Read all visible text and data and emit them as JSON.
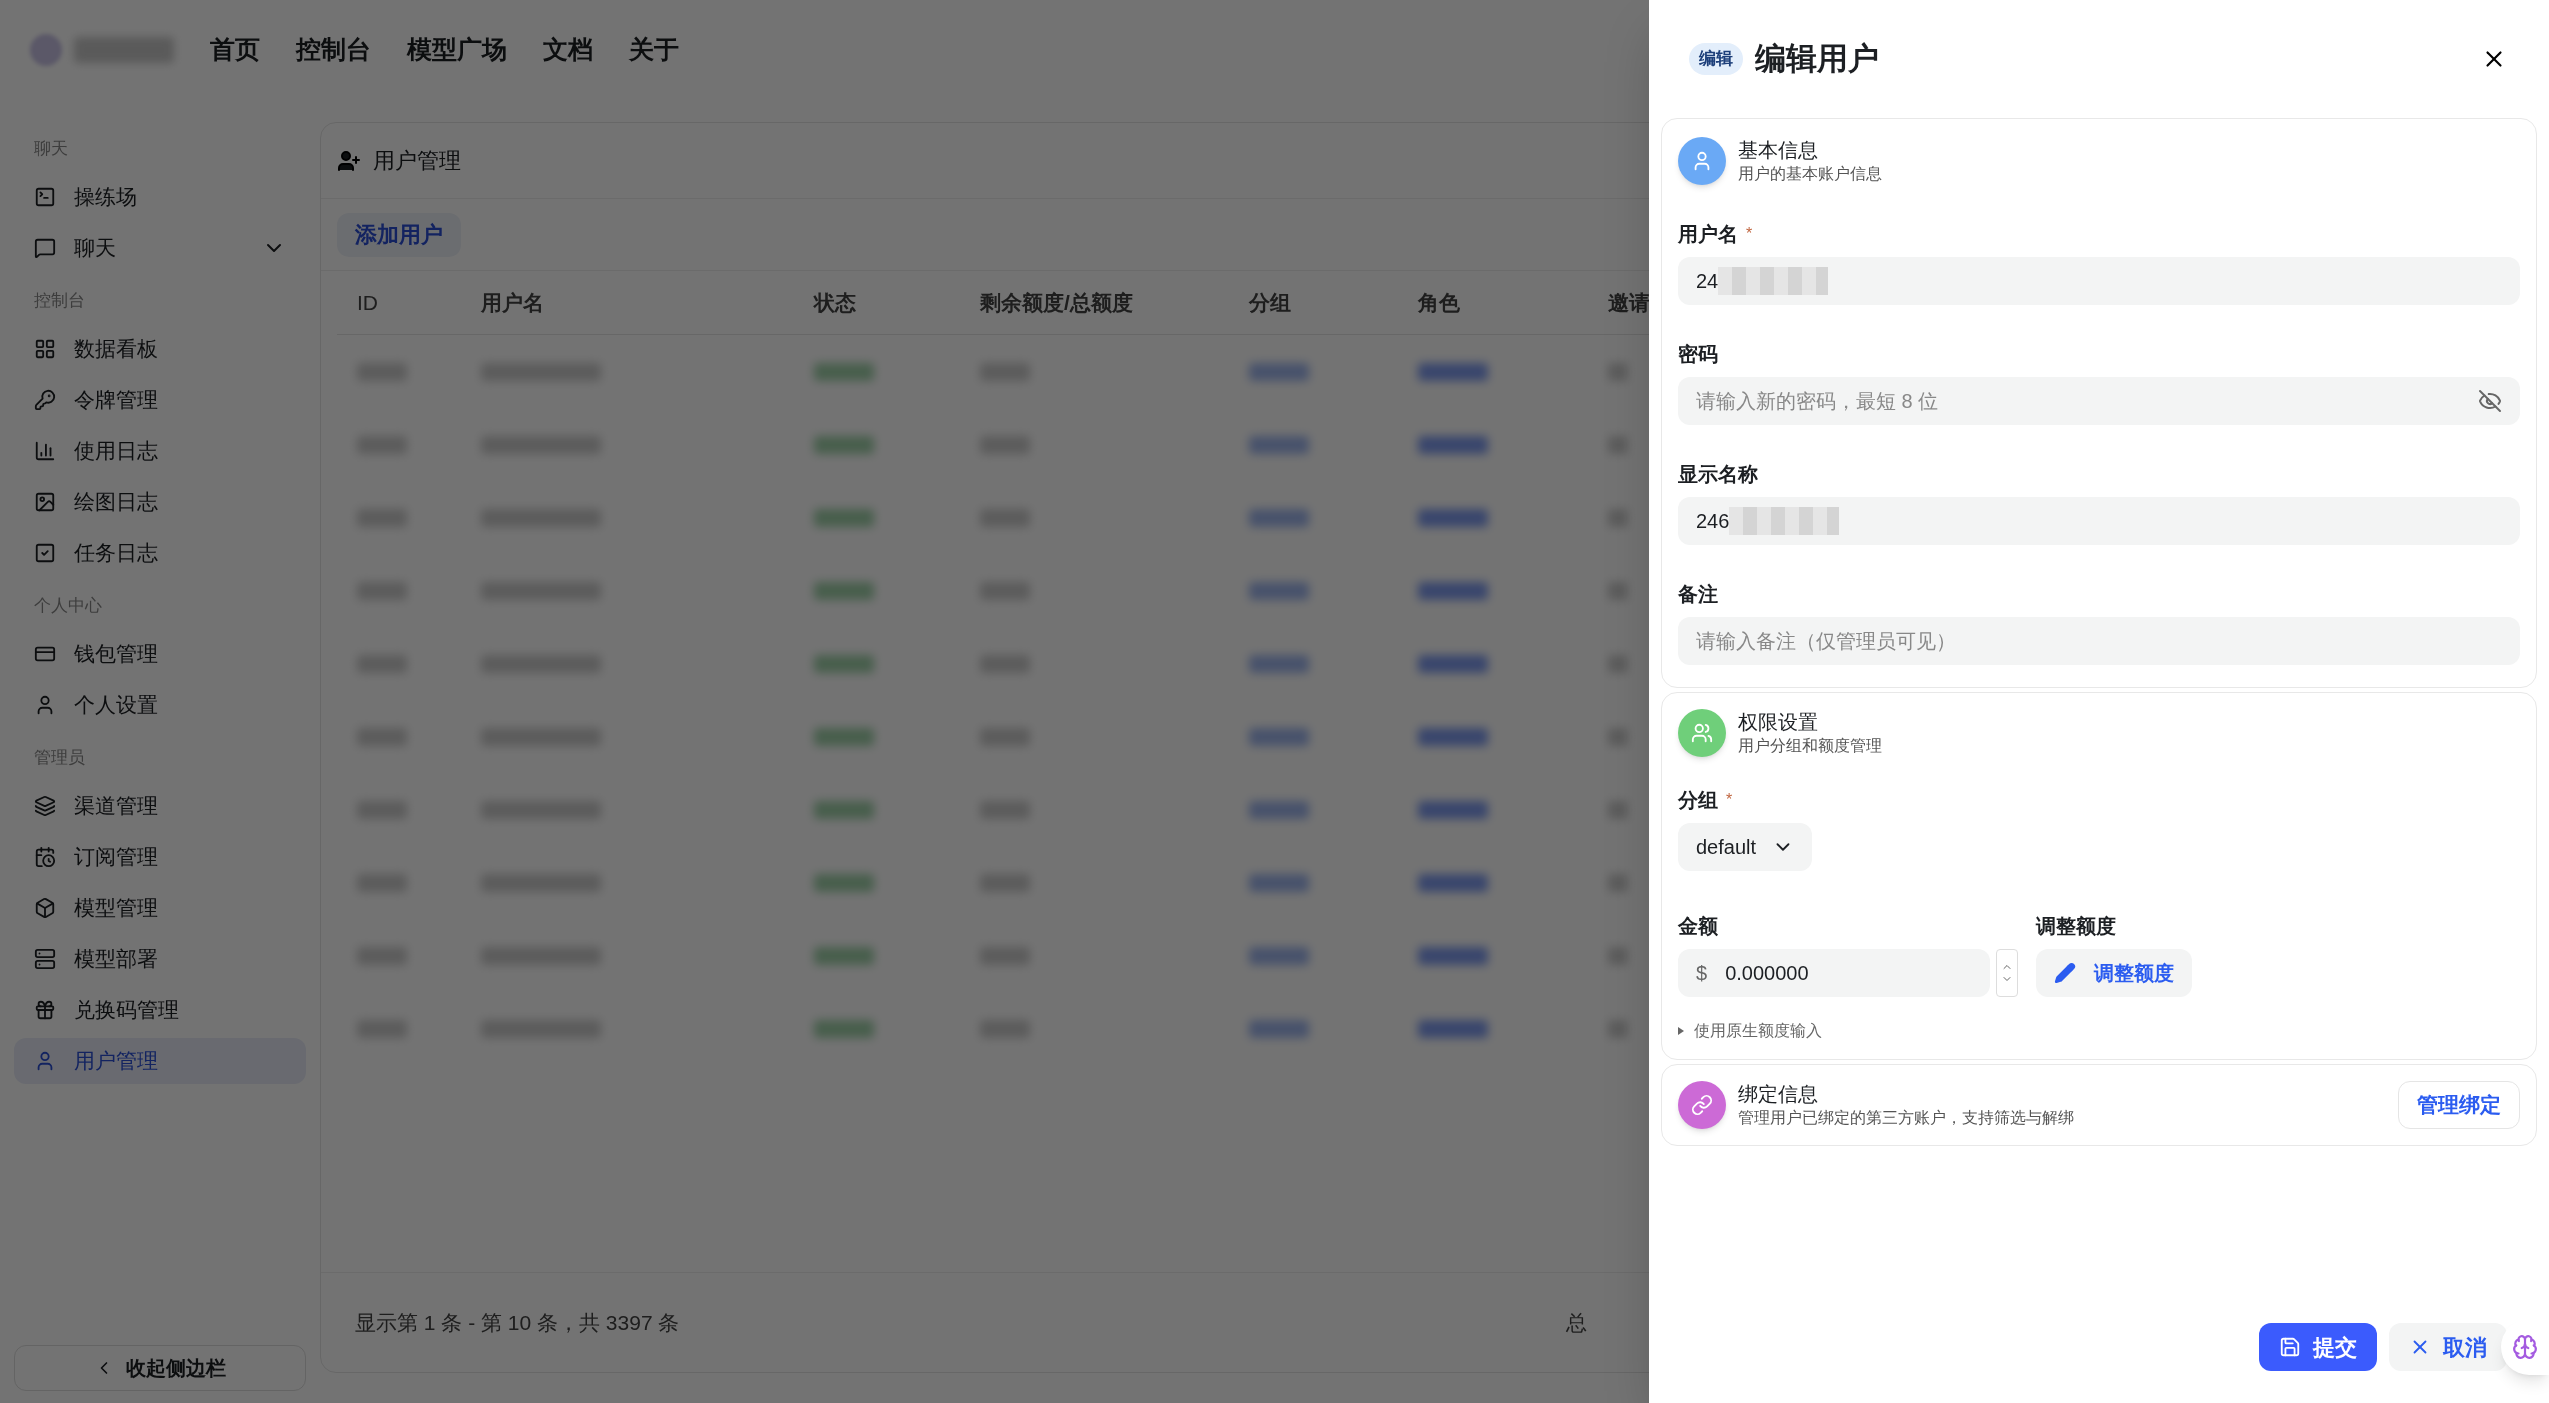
{
  "nav": [
    "首页",
    "控制台",
    "模型广场",
    "文档",
    "关于"
  ],
  "sidebar": {
    "groups": [
      {
        "title": "聊天",
        "items": [
          {
            "label": "操练场",
            "submenu": false,
            "selected": false
          },
          {
            "label": "聊天",
            "submenu": true,
            "selected": false
          }
        ]
      },
      {
        "title": "控制台",
        "items": [
          {
            "label": "数据看板",
            "submenu": false,
            "selected": false
          },
          {
            "label": "令牌管理",
            "submenu": false,
            "selected": false
          },
          {
            "label": "使用日志",
            "submenu": false,
            "selected": false
          },
          {
            "label": "绘图日志",
            "submenu": false,
            "selected": false
          },
          {
            "label": "任务日志",
            "submenu": false,
            "selected": false
          }
        ]
      },
      {
        "title": "个人中心",
        "items": [
          {
            "label": "钱包管理",
            "submenu": false,
            "selected": false
          },
          {
            "label": "个人设置",
            "submenu": false,
            "selected": false
          }
        ]
      },
      {
        "title": "管理员",
        "items": [
          {
            "label": "渠道管理",
            "submenu": false,
            "selected": false
          },
          {
            "label": "订阅管理",
            "submenu": false,
            "selected": false
          },
          {
            "label": "模型管理",
            "submenu": false,
            "selected": false
          },
          {
            "label": "模型部署",
            "submenu": false,
            "selected": false
          },
          {
            "label": "兑换码管理",
            "submenu": false,
            "selected": false
          },
          {
            "label": "用户管理",
            "submenu": false,
            "selected": true
          }
        ]
      }
    ],
    "collapse": "收起侧边栏"
  },
  "page": {
    "title": "用户管理",
    "add_button": "添加用户",
    "columns": [
      "ID",
      "用户名",
      "状态",
      "剩余额度/总额度",
      "分组",
      "角色",
      "邀请"
    ],
    "summary": "显示第 1 条 - 第 10 条，共 3397 条",
    "pager": "总"
  },
  "drawer": {
    "badge": "编辑",
    "title": "编辑用户",
    "required_mark": "*",
    "basic": {
      "title": "基本信息",
      "subtitle": "用户的基本账户信息",
      "color": "#6aa9f5",
      "fields": [
        {
          "kind": "text",
          "label": "用户名",
          "required": true,
          "value": "24",
          "redacted": true
        },
        {
          "kind": "password",
          "label": "密码",
          "required": false,
          "placeholder": "请输入新的密码，最短 8 位",
          "redacted": false
        },
        {
          "kind": "text",
          "label": "显示名称",
          "required": false,
          "value": "246",
          "redacted": true
        },
        {
          "kind": "text",
          "label": "备注",
          "required": false,
          "placeholder": "请输入备注（仅管理员可见）",
          "redacted": false
        }
      ]
    },
    "permissions": {
      "title": "权限设置",
      "subtitle": "用户分组和额度管理",
      "color": "#6fcf7a",
      "group_label": "分组",
      "group_required": true,
      "group_value": "default",
      "amount_label": "金额",
      "currency": "$",
      "amount": "0.000000",
      "adjust_label": "调整额度",
      "adjust_button": "调整额度",
      "native_toggle": "使用原生额度输入"
    },
    "binding": {
      "title": "绑定信息",
      "subtitle": "管理用户已绑定的第三方账户，支持筛选与解绑",
      "color": "#cc6ad6",
      "button": "管理绑定"
    },
    "submit": "提交",
    "cancel": "取消"
  }
}
